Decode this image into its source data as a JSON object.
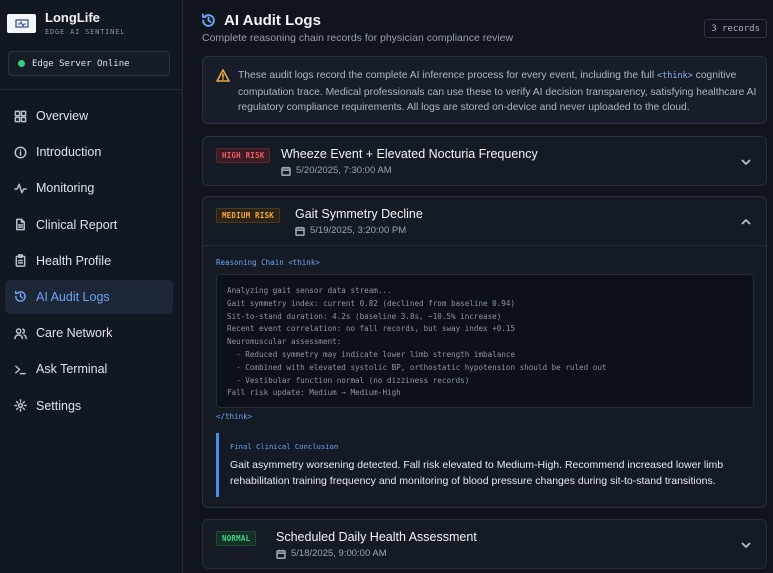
{
  "brand": {
    "name": "LongLife",
    "subtitle": "EDGE AI SENTINEL"
  },
  "server_status": {
    "label": "Edge Server Online",
    "color": "#34d37a"
  },
  "nav": [
    {
      "label": "Overview",
      "icon": "grid-icon",
      "active": false
    },
    {
      "label": "Introduction",
      "icon": "info-icon",
      "active": false
    },
    {
      "label": "Monitoring",
      "icon": "activity-icon",
      "active": false
    },
    {
      "label": "Clinical Report",
      "icon": "file-icon",
      "active": false
    },
    {
      "label": "Health Profile",
      "icon": "clipboard-icon",
      "active": false
    },
    {
      "label": "AI Audit Logs",
      "icon": "history-icon",
      "active": true
    },
    {
      "label": "Care Network",
      "icon": "users-icon",
      "active": false
    },
    {
      "label": "Ask Terminal",
      "icon": "terminal-icon",
      "active": false
    },
    {
      "label": "Settings",
      "icon": "gear-icon",
      "active": false
    }
  ],
  "page": {
    "title": "AI Audit Logs",
    "subtitle": "Complete reasoning chain records for physician compliance review",
    "records": "3 records"
  },
  "notice": {
    "before": "These audit logs record the complete AI inference process for every event, including the full ",
    "code": "<think>",
    "after": " cognitive computation trace. Medical professionals can use these to verify AI decision transparency, satisfying healthcare AI regulatory compliance requirements. All logs are stored on-device and never uploaded to the cloud."
  },
  "logs": [
    {
      "badge": "HIGH RISK",
      "title": "Wheeze Event + Elevated Nocturia Frequency",
      "date": "5/20/2025, 7:30:00 AM"
    },
    {
      "badge": "MEDIUM RISK",
      "title": "Gait Symmetry Decline",
      "date": "5/19/2025, 3:20:00 PM",
      "chain_label": "Reasoning Chain <think>",
      "chain_end": "</think>",
      "chain": [
        "Analyzing gait sensor data stream...",
        "Gait symmetry index: current 0.82 (declined from baseline 0.94)",
        "Sit-to-stand duration: 4.2s (baseline 3.8s, ~10.5% increase)",
        "Recent event correlation: no fall records, but sway index +0.15",
        "Neuromuscular assessment:",
        "  - Reduced symmetry may indicate lower limb strength imbalance",
        "  - Combined with elevated systolic BP, orthostatic hypotension should be ruled out",
        "  - Vestibular function normal (no dizziness records)",
        "Fall risk update: Medium → Medium-High"
      ],
      "conclusion_label": "Final Clinical Conclusion",
      "conclusion": "Gait asymmetry worsening detected. Fall risk elevated to Medium-High. Recommend increased lower limb rehabilitation training frequency and monitoring of blood pressure changes during sit-to-stand transitions."
    },
    {
      "badge": "NORMAL",
      "title": "Scheduled Daily Health Assessment",
      "date": "5/18/2025, 9:00:00 AM"
    }
  ]
}
